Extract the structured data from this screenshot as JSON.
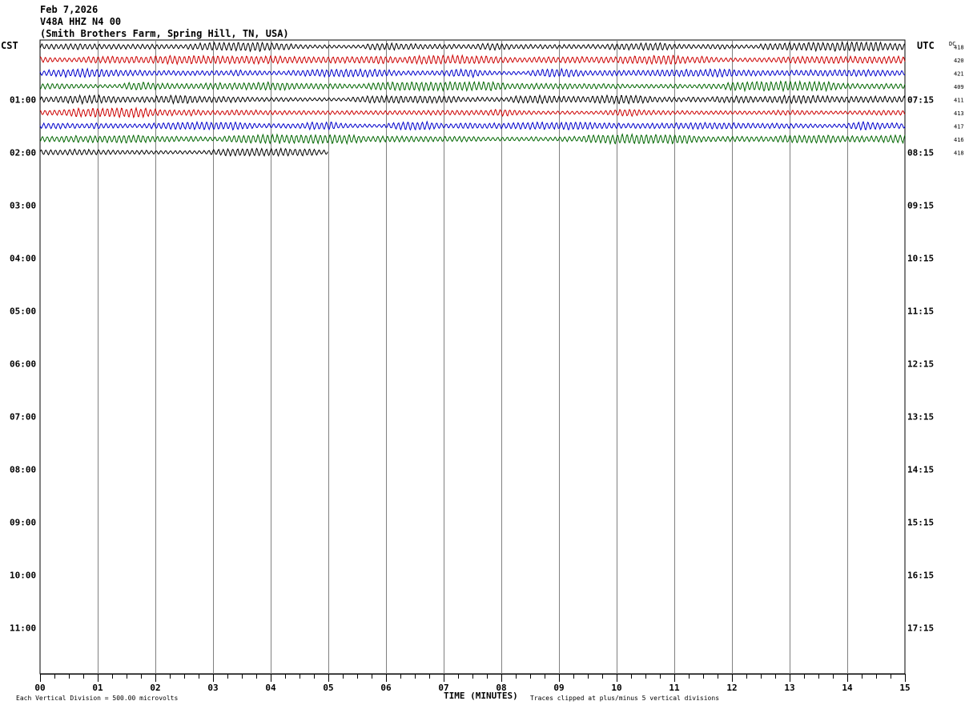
{
  "header": {
    "date": "Feb 7,2026",
    "station": "V48A HHZ N4 00",
    "location": "(Smith Brothers Farm, Spring Hill, TN, USA)"
  },
  "left_timezone": "CST",
  "right_timezone": "UTC",
  "dc_label": "DC",
  "footer": {
    "scale_note": "Each Vertical Division =  500.00 microvolts",
    "xlabel": "TIME (MINUTES)",
    "clip_note": "Traces clipped at plus/minus 5 vertical divisions"
  },
  "colors": {
    "grid": "#808080",
    "frame": "#000000",
    "trace_cycle": [
      "#000000",
      "#cc0000",
      "#0000cc",
      "#006600"
    ]
  },
  "chart_data": {
    "type": "line",
    "title": "Feb 7,2026",
    "subtitle": "V48A HHZ N4 00 (Smith Brothers Farm, Spring Hill, TN, USA)",
    "xlabel": "TIME (MINUTES)",
    "ylabel": "",
    "xlim": [
      0,
      15
    ],
    "x_ticks": [
      "00",
      "01",
      "02",
      "03",
      "04",
      "05",
      "06",
      "07",
      "08",
      "09",
      "10",
      "11",
      "12",
      "13",
      "14",
      "15"
    ],
    "minor_tick_step_minutes": 0.25,
    "row_minutes": 15,
    "rows_total": 48,
    "y_left_labels": [
      {
        "row": 4,
        "label": "01:00"
      },
      {
        "row": 8,
        "label": "02:00"
      },
      {
        "row": 12,
        "label": "03:00"
      },
      {
        "row": 16,
        "label": "04:00"
      },
      {
        "row": 20,
        "label": "05:00"
      },
      {
        "row": 24,
        "label": "06:00"
      },
      {
        "row": 28,
        "label": "07:00"
      },
      {
        "row": 32,
        "label": "08:00"
      },
      {
        "row": 36,
        "label": "09:00"
      },
      {
        "row": 40,
        "label": "10:00"
      },
      {
        "row": 44,
        "label": "11:00"
      }
    ],
    "y_right_labels": [
      {
        "row": 4,
        "label": "07:15"
      },
      {
        "row": 8,
        "label": "08:15"
      },
      {
        "row": 12,
        "label": "09:15"
      },
      {
        "row": 16,
        "label": "10:15"
      },
      {
        "row": 20,
        "label": "11:15"
      },
      {
        "row": 24,
        "label": "12:15"
      },
      {
        "row": 28,
        "label": "13:15"
      },
      {
        "row": 32,
        "label": "14:15"
      },
      {
        "row": 36,
        "label": "15:15"
      },
      {
        "row": 40,
        "label": "16:15"
      },
      {
        "row": 44,
        "label": "17:15"
      }
    ],
    "traces": [
      {
        "row": 0,
        "dc": "418",
        "minutes": 15
      },
      {
        "row": 1,
        "dc": "420",
        "minutes": 15
      },
      {
        "row": 2,
        "dc": "421",
        "minutes": 15
      },
      {
        "row": 3,
        "dc": "409",
        "minutes": 15
      },
      {
        "row": 4,
        "dc": "411",
        "minutes": 15
      },
      {
        "row": 5,
        "dc": "413",
        "minutes": 15
      },
      {
        "row": 6,
        "dc": "417",
        "minutes": 15
      },
      {
        "row": 7,
        "dc": "416",
        "minutes": 15
      },
      {
        "row": 8,
        "dc": "418",
        "minutes": 5
      }
    ],
    "grid": true,
    "legend": "none"
  }
}
